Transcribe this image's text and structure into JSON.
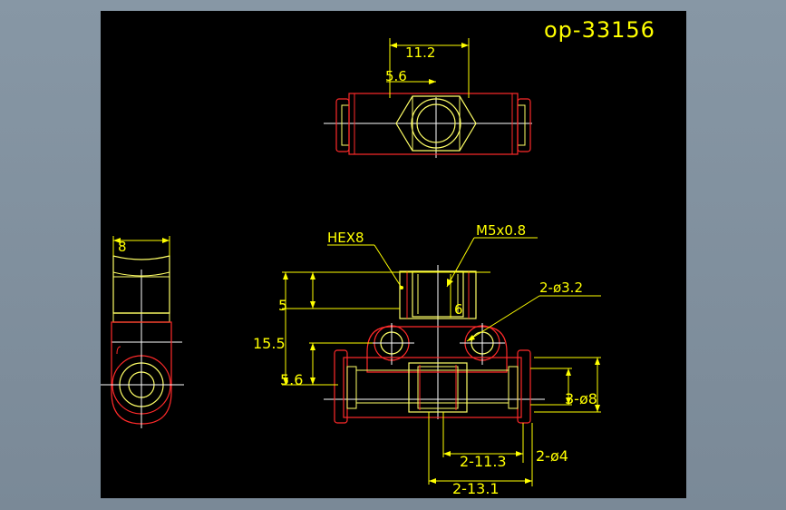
{
  "drawing": {
    "title": "op-33156",
    "background": "#000000",
    "colors": {
      "outline": "#ff2a2a",
      "dimension": "#ffff00",
      "centerline": "#ffffff",
      "body": "#ffff66"
    }
  },
  "dimensions": {
    "top_width": "11.2",
    "top_half": "5.6",
    "side_width": "8",
    "hex": "HEX8",
    "thread": "M5x0.8",
    "holes": "2-ø3.2",
    "h_5": "5",
    "h_6": "6",
    "h_15_5": "15.5",
    "h_5_6": "5.6",
    "tube_dia": "3-ø8",
    "port_dia": "2-ø4",
    "len_11_3": "2-11.3",
    "len_13_1": "2-13.1"
  }
}
